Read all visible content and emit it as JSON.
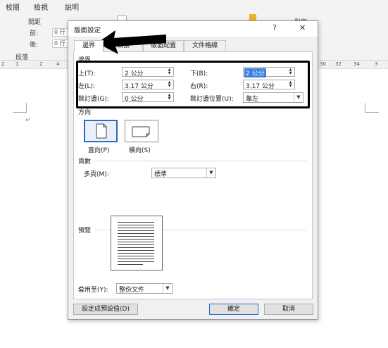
{
  "ribbon": {
    "tabs": [
      "校閱",
      "檢視",
      "說明"
    ],
    "group_label_spacing": "間距",
    "before_label": "前:",
    "after_label": "後:",
    "before_value": "0 行",
    "after_value": "0 行",
    "paragraph_group": "段落",
    "align_label": "對齊"
  },
  "ruler": {
    "ticks": [
      "2",
      "1",
      "2",
      "4",
      "30",
      "32",
      "34",
      "3"
    ]
  },
  "dialog": {
    "title": "版面設定",
    "help": "?",
    "close": "✕",
    "tabs": [
      "邊界",
      "紙張",
      "版面配置",
      "文件格線"
    ],
    "active_tab": 0,
    "margins_section": "邊界",
    "top_label": "上(T):",
    "top_value": "2 公分",
    "bottom_label": "下(B):",
    "bottom_value": "2 公分",
    "left_label": "左(L):",
    "left_value": "3.17 公分",
    "right_label": "右(R):",
    "right_value": "3.17 公分",
    "gutter_label": "裝訂邊(G):",
    "gutter_value": "0 公分",
    "gutter_pos_label": "裝訂邊位置(U):",
    "gutter_pos_value": "靠左",
    "orientation_section": "方向",
    "portrait_label": "直向(P)",
    "landscape_label": "橫向(S)",
    "pages_section": "頁數",
    "multiple_pages_label": "多頁(M):",
    "multiple_pages_value": "標準",
    "preview_section": "預覽",
    "apply_to_label": "套用至(Y):",
    "apply_to_value": "整份文件",
    "set_default_button": "設定成預設值(D)",
    "ok_button": "確定",
    "cancel_button": "取消"
  },
  "colors": {
    "accent": "#2b6cc4",
    "selection": "#3b7fdf",
    "annotation": "#000000"
  }
}
